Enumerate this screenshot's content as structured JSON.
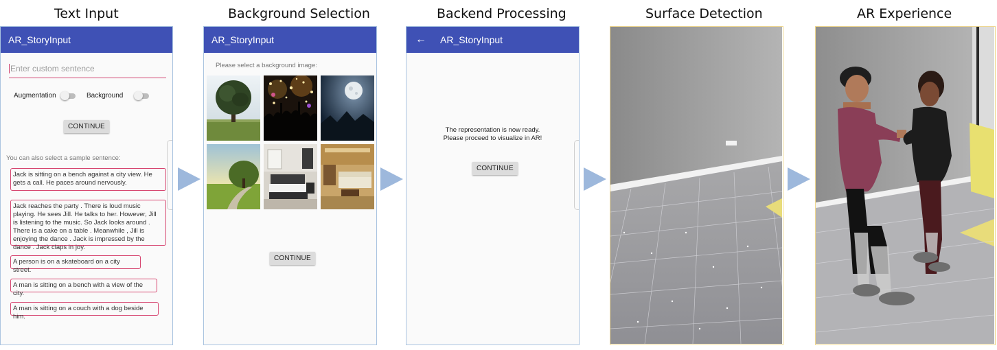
{
  "titles": [
    "Text Input",
    "Background Selection",
    "Backend Processing",
    "Surface Detection",
    "AR Experience"
  ],
  "app_title": "AR_StoryInput",
  "text_input": {
    "placeholder": "Enter custom sentence",
    "augmentation_label": "Augmentation",
    "background_label": "Background",
    "continue_label": "CONTINUE",
    "sample_hint": "You can also select a sample sentence:",
    "samples": [
      "Jack is sitting on a bench against a city view. He gets a call. He paces around nervously.",
      "Jack reaches the party . There is loud music playing. He sees Jill. He talks to her. However, Jill is listening to the music. So Jack looks around . There is a cake on a table .  Meanwhile , Jill is enjoying the dance . Jack is impressed by the dance . Jack claps in joy.",
      "A person is on a skateboard on a city street.",
      "A man is sitting on a bench with a view of the city.",
      "A man is sitting on a couch with a dog beside him."
    ]
  },
  "background_selection": {
    "prompt": "Please select a background image:",
    "continue_label": "CONTINUE"
  },
  "backend_processing": {
    "back_icon": "←",
    "message_line1": "The representation is now ready.",
    "message_line2": "Please proceed to visualize in AR!",
    "continue_label": "CONTINUE"
  },
  "colors": {
    "appbar": "#3f51b5",
    "accent": "#d6456f",
    "arrow": "#9db8dc"
  }
}
